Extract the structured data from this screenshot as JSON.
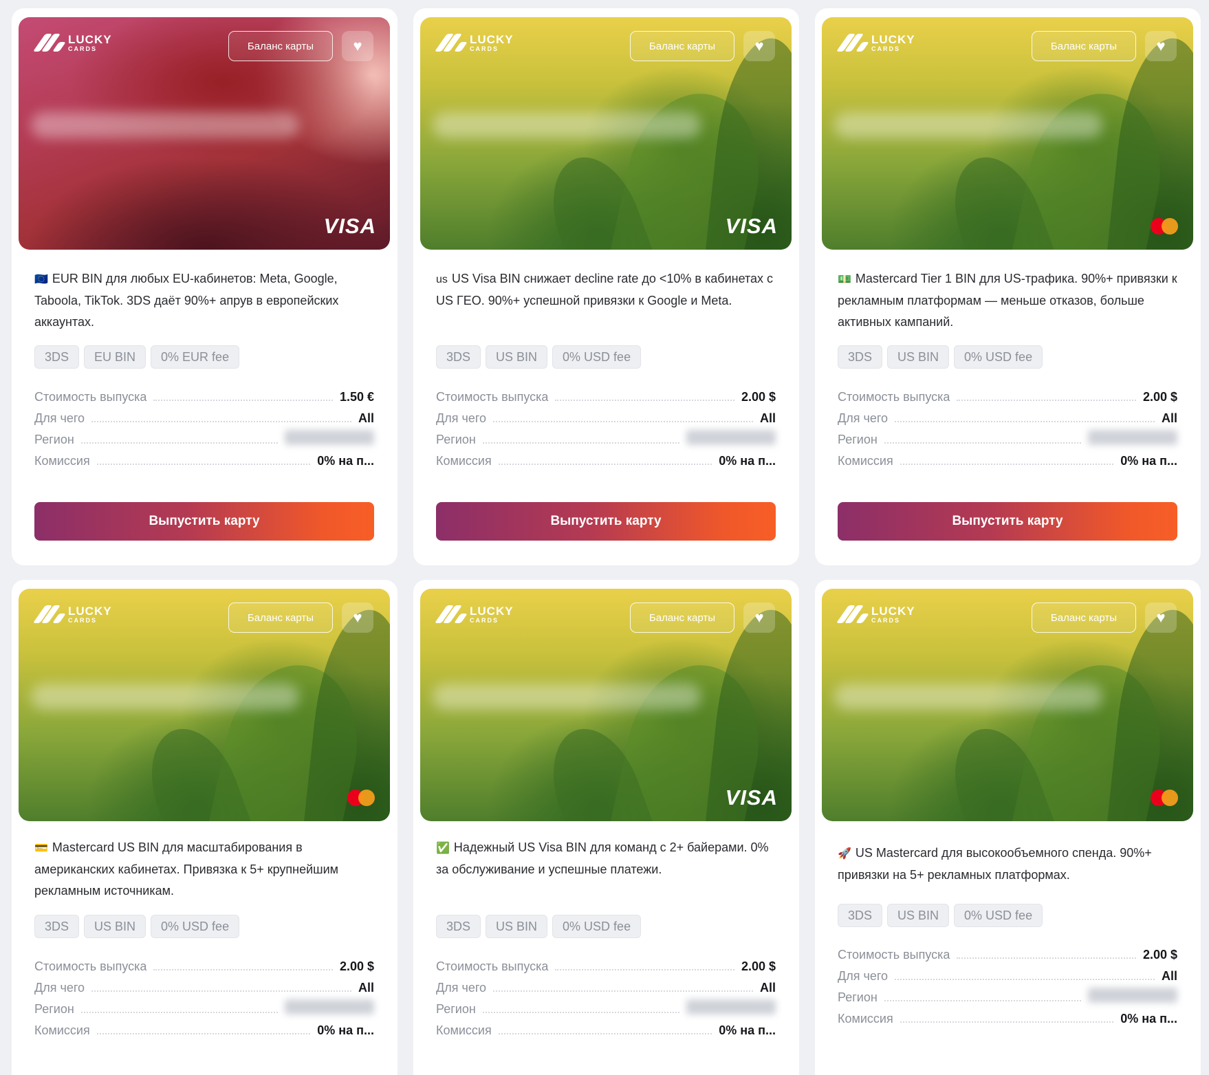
{
  "common": {
    "brand_line1": "LUCKY",
    "brand_line2": "CARDS",
    "balance_label": "Баланс карты",
    "issue_label": "Выпустить карту",
    "prop_cost": "Стоимость выпуска",
    "prop_for": "Для чего",
    "prop_region": "Регион",
    "prop_fee": "Комиссия"
  },
  "colors": {
    "button_gradient_start": "#8c2f68",
    "button_gradient_end": "#f75e26",
    "page_bg": "#eef0f3"
  },
  "cards": [
    {
      "scheme": "VISA",
      "theme": "red",
      "emoji": "🇪🇺",
      "description": "EUR BIN для любых EU-кабинетов: Meta, Google, Taboola, TikTok. 3DS даёт 90%+ апрув в европейских аккаунтах.",
      "tags": [
        "3DS",
        "EU BIN",
        "0% EUR fee"
      ],
      "cost": "1.50 €",
      "for": "All",
      "fee": "0% на п..."
    },
    {
      "scheme": "VISA",
      "theme": "green",
      "emoji": "us",
      "description": "US Visa BIN снижает decline rate до <10% в кабинетах с US ГЕО. 90%+ успешной привязки к Google и Meta.",
      "tags": [
        "3DS",
        "US BIN",
        "0% USD fee"
      ],
      "cost": "2.00 $",
      "for": "All",
      "fee": "0% на п..."
    },
    {
      "scheme": "mastercard",
      "theme": "green",
      "emoji": "💵",
      "description": "Mastercard Tier 1 BIN для US-трафика. 90%+ привязки к рекламным платформам — меньше отказов, больше активных кампаний.",
      "tags": [
        "3DS",
        "US BIN",
        "0% USD fee"
      ],
      "cost": "2.00 $",
      "for": "All",
      "fee": "0% на п..."
    },
    {
      "scheme": "mastercard",
      "theme": "green",
      "emoji": "💳",
      "description": "Mastercard US BIN для масштабирования в американских кабинетах. Привязка к 5+ крупнейшим рекламным источникам.",
      "tags": [
        "3DS",
        "US BIN",
        "0% USD fee"
      ],
      "cost": "2.00 $",
      "for": "All",
      "fee": "0% на п..."
    },
    {
      "scheme": "VISA",
      "theme": "green",
      "emoji": "✅",
      "description": "Надежный US Visa BIN для команд с 2+ байерами. 0% за обслуживание и успешные платежи.",
      "tags": [
        "3DS",
        "US BIN",
        "0% USD fee"
      ],
      "cost": "2.00 $",
      "for": "All",
      "fee": "0% на п..."
    },
    {
      "scheme": "mastercard",
      "theme": "green",
      "emoji": "🚀",
      "description": "US Mastercard для высокообъемного спенда. 90%+ привязки на 5+ рекламных платформах.",
      "tags": [
        "3DS",
        "US BIN",
        "0% USD fee"
      ],
      "cost": "2.00 $",
      "for": "All",
      "fee": "0% на п..."
    }
  ]
}
